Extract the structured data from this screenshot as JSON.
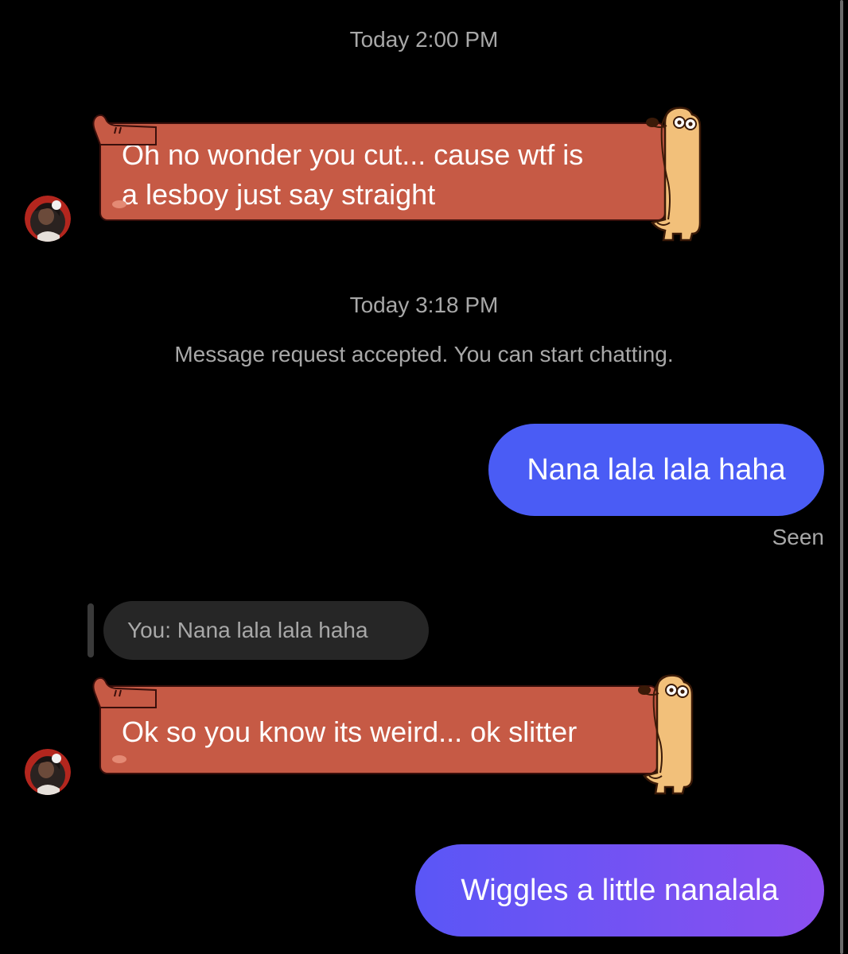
{
  "thread": {
    "timestamp_1": "Today 2:00 PM",
    "received_1": {
      "line_1": "Oh no wonder you cut... cause wtf is",
      "line_2": "a lesboy just say straight"
    },
    "timestamp_2": "Today 3:18 PM",
    "system_message": "Message request accepted. You can start chatting.",
    "sent_1": "Nana lala lala haha",
    "seen_label": "Seen",
    "reply_preview": "You: Nana lala lala haha",
    "received_2": "Ok so you know its weird... ok slitter",
    "sent_2": "Wiggles a little nanalala"
  },
  "colors": {
    "background": "#000000",
    "received_bubble": "#c65a45",
    "sent_bubble_blue": "#4a5cf5",
    "sent_bubble_purple": "#8b4ff0",
    "secondary_text": "#a8a8a8"
  },
  "icons": {
    "bubble_theme": "dachshund-dog-theme",
    "avatar": "contact-avatar"
  }
}
